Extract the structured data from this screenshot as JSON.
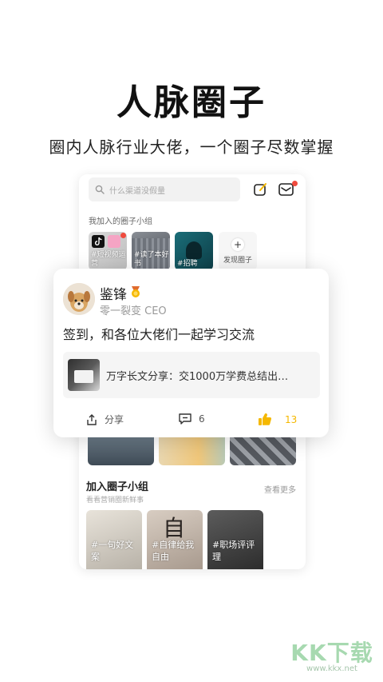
{
  "hero": {
    "title": "人脉圈子",
    "subtitle": "圈内人脉行业大佬，一个圈子尽数掌握"
  },
  "app": {
    "search_placeholder": "什么渠道没假量",
    "my_groups_title": "我加入的圈子小组",
    "my_groups": [
      {
        "tag": "#短视频运营",
        "line1": "#短视频运",
        "line2": "营"
      },
      {
        "tag": "#读了本好书",
        "line1": "#读了本好",
        "line2": "书"
      },
      {
        "tag": "#招聘",
        "line1": "#招聘",
        "line2": ""
      }
    ],
    "discover_label": "发现圈子",
    "join_title": "加入圈子小组",
    "join_more": "查看更多",
    "join_subtitle": "看看营销圈新鲜事",
    "join_groups": [
      {
        "line1": "#一句好文",
        "line2": "案"
      },
      {
        "line1": "#自律给我",
        "line2": "自由"
      },
      {
        "line1": "#职场评评",
        "line2": "理"
      }
    ]
  },
  "post": {
    "username": "鉴锋",
    "user_title": "零一裂变 CEO",
    "text": "签到，和各位大佬们一起学习交流",
    "link_text": "万字长文分享：交1000万学费总结出…",
    "share_label": "分享",
    "comment_count": "6",
    "like_count": "13"
  },
  "watermark": {
    "logo": "KK下载",
    "url": "www.kkx.net"
  },
  "colors": {
    "accent_like": "#f5b800",
    "badge_red": "#f04a3e"
  },
  "icons": [
    "search-icon",
    "edit-icon",
    "mail-icon",
    "tiktok-icon",
    "plus-icon",
    "medal-icon",
    "share-icon",
    "comment-icon",
    "thumbs-up-icon"
  ]
}
